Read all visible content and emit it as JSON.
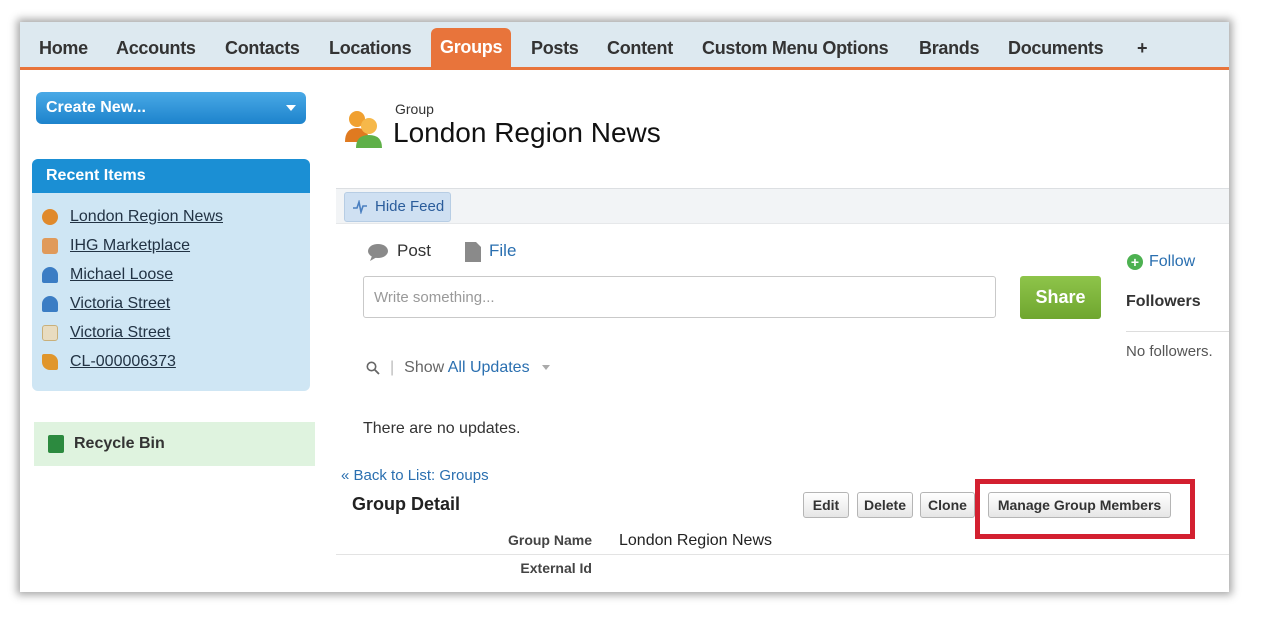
{
  "tabs": [
    {
      "label": "Home",
      "active": false
    },
    {
      "label": "Accounts",
      "active": false
    },
    {
      "label": "Contacts",
      "active": false
    },
    {
      "label": "Locations",
      "active": false
    },
    {
      "label": "Groups",
      "active": true
    },
    {
      "label": "Posts",
      "active": false
    },
    {
      "label": "Content",
      "active": false
    },
    {
      "label": "Custom Menu Options",
      "active": false
    },
    {
      "label": "Brands",
      "active": false
    },
    {
      "label": "Documents",
      "active": false
    },
    {
      "label": "+",
      "active": false
    }
  ],
  "sidebar": {
    "create_new_label": "Create New...",
    "recent_items_title": "Recent Items",
    "recent_items": [
      {
        "label": "London Region News",
        "icon": "group-icon",
        "color": "#e08a2c"
      },
      {
        "label": "IHG Marketplace",
        "icon": "marketplace-icon",
        "color": "#e09a5a"
      },
      {
        "label": "Michael Loose",
        "icon": "contact-icon",
        "color": "#3b7dc4"
      },
      {
        "label": "Victoria Street",
        "icon": "contact-icon",
        "color": "#3b7dc4"
      },
      {
        "label": "Victoria Street",
        "icon": "location-icon",
        "color": "#c9b07a"
      },
      {
        "label": "CL-000006373",
        "icon": "custom-object-icon",
        "color": "#e0962c"
      }
    ],
    "recycle_bin_label": "Recycle Bin"
  },
  "header": {
    "object_label": "Group",
    "record_title": "London Region News"
  },
  "feed": {
    "hide_feed_label": "Hide Feed",
    "post_tab_label": "Post",
    "file_tab_label": "File",
    "post_placeholder": "Write something...",
    "share_label": "Share",
    "follow_label": "Follow",
    "followers_title": "Followers",
    "no_followers_text": "No followers.",
    "show_label": "Show",
    "show_value": "All Updates",
    "no_updates_text": "There are no updates."
  },
  "detail": {
    "back_link": "« Back to List: Groups",
    "section_title": "Group Detail",
    "buttons": {
      "edit": "Edit",
      "delete": "Delete",
      "clone": "Clone",
      "manage_members": "Manage Group Members"
    },
    "fields": [
      {
        "label": "Group Name",
        "value": "London Region News"
      },
      {
        "label": "External Id",
        "value": ""
      }
    ]
  },
  "colors": {
    "accent_tab": "#e8743b",
    "highlight_box": "#d32030",
    "share_button": "#7cb63c",
    "recent_header": "#1b8fd4"
  }
}
